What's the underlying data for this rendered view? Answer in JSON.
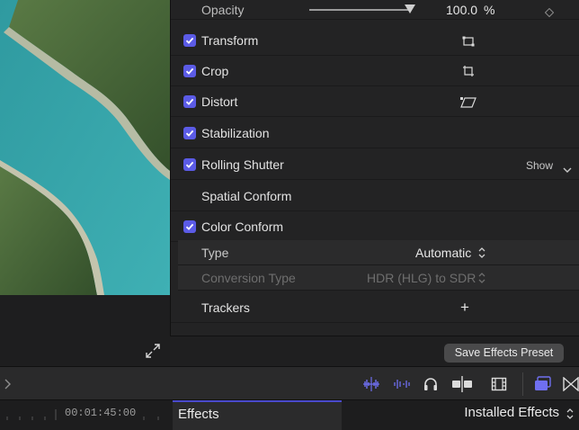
{
  "inspector": {
    "opacity": {
      "label": "Opacity",
      "value": "100.0",
      "unit": "%",
      "slider_fraction": 1.0
    },
    "sections": [
      {
        "label": "Transform",
        "checked": true,
        "icon": "transform-icon"
      },
      {
        "label": "Crop",
        "checked": true,
        "icon": "crop-icon"
      },
      {
        "label": "Distort",
        "checked": true,
        "icon": "distort-icon"
      },
      {
        "label": "Stabilization",
        "checked": true
      },
      {
        "label": "Rolling Shutter",
        "checked": true,
        "action": "Show"
      },
      {
        "label": "Spatial Conform",
        "checked": false
      },
      {
        "label": "Color Conform",
        "checked": true
      }
    ],
    "color_conform": {
      "type_label": "Type",
      "type_value": "Automatic",
      "conversion_label": "Conversion Type",
      "conversion_value": "HDR (HLG) to SDR"
    },
    "trackers": {
      "label": "Trackers",
      "add": "+"
    },
    "save_preset": "Save Effects Preset"
  },
  "timeline": {
    "timecode": "00:01:45:00",
    "effects_tab": "Effects",
    "installed_effects": "Installed Effects"
  },
  "colors": {
    "accent": "#5b5be6",
    "water": "#3aa3a8",
    "hill": "#3f5a33"
  }
}
